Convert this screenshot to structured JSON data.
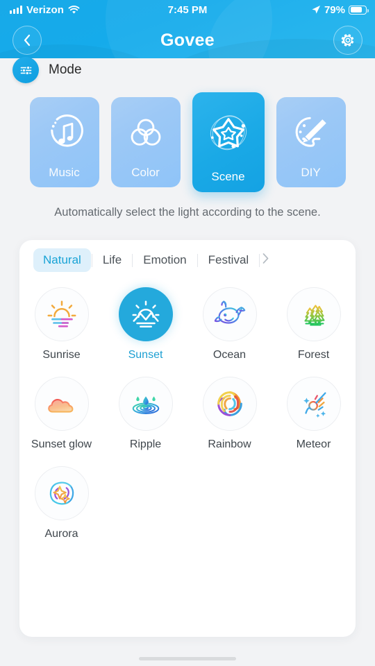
{
  "status_bar": {
    "carrier": "Verizon",
    "signal_icon": "signal-bars-icon",
    "wifi_icon": "wifi-icon",
    "time": "7:45 PM",
    "location_icon": "location-arrow-icon",
    "battery_percent": "79%",
    "battery_icon": "battery-icon"
  },
  "header": {
    "back_icon": "chevron-left-icon",
    "brand": "Govee",
    "settings_icon": "gear-icon",
    "accent": "#18A9E8"
  },
  "mode_section": {
    "badge_icon": "sliders-icon",
    "title": "Mode",
    "hint": "Automatically select the light according to the scene.",
    "cards": [
      {
        "label": "Music",
        "icon": "music-note-icon",
        "selected": false
      },
      {
        "label": "Color",
        "icon": "color-circles-icon",
        "selected": false
      },
      {
        "label": "Scene",
        "icon": "star-orbit-icon",
        "selected": true
      },
      {
        "label": "DIY",
        "icon": "paint-palette-icon",
        "selected": false
      }
    ]
  },
  "scene_panel": {
    "tabs": [
      {
        "label": "Natural",
        "active": true
      },
      {
        "label": "Life",
        "active": false
      },
      {
        "label": "Emotion",
        "active": false
      },
      {
        "label": "Festival",
        "active": false
      }
    ],
    "more_tabs_icon": "chevron-right-icon",
    "selected_color": "#24A9DC",
    "scenes": [
      {
        "label": "Sunrise",
        "icon": "sunrise-icon",
        "selected": false
      },
      {
        "label": "Sunset",
        "icon": "sunset-icon",
        "selected": true
      },
      {
        "label": "Ocean",
        "icon": "whale-icon",
        "selected": false
      },
      {
        "label": "Forest",
        "icon": "trees-icon",
        "selected": false
      },
      {
        "label": "Sunset glow",
        "icon": "cloud-glow-icon",
        "selected": false
      },
      {
        "label": "Ripple",
        "icon": "water-ripple-icon",
        "selected": false
      },
      {
        "label": "Rainbow",
        "icon": "rainbow-swirl-icon",
        "selected": false
      },
      {
        "label": "Meteor",
        "icon": "meteor-icon",
        "selected": false
      },
      {
        "label": "Aurora",
        "icon": "aurora-icon",
        "selected": false
      }
    ]
  }
}
